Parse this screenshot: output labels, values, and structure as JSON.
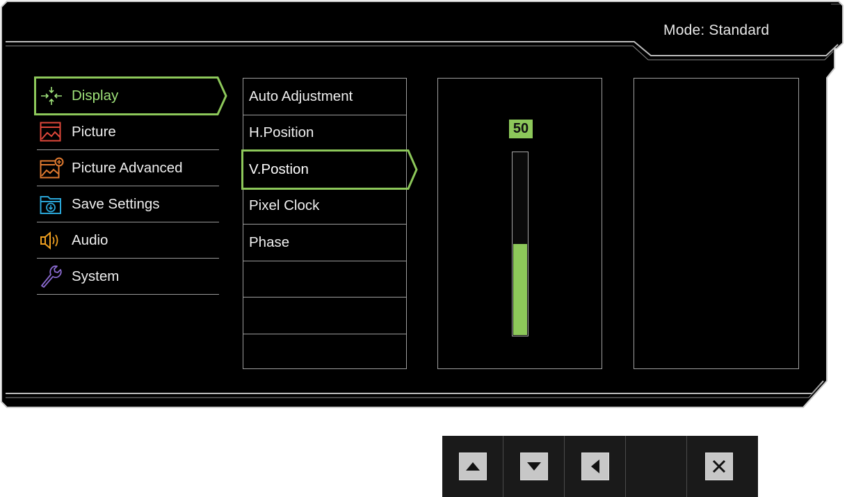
{
  "header": {
    "mode_text": "Mode: Standard"
  },
  "menu": {
    "items": [
      {
        "label": "Display",
        "icon": "display-adjust-icon",
        "selected": true
      },
      {
        "label": "Picture",
        "icon": "picture-icon"
      },
      {
        "label": "Picture Advanced",
        "icon": "picture-advanced-icon"
      },
      {
        "label": "Save Settings",
        "icon": "save-settings-icon"
      },
      {
        "label": "Audio",
        "icon": "audio-icon"
      },
      {
        "label": "System",
        "icon": "system-wrench-icon"
      }
    ]
  },
  "submenu": {
    "items": [
      {
        "label": "Auto Adjustment"
      },
      {
        "label": "H.Position"
      },
      {
        "label": "V.Postion",
        "selected": true
      },
      {
        "label": "Pixel Clock"
      },
      {
        "label": "Phase"
      },
      {
        "label": ""
      },
      {
        "label": ""
      },
      {
        "label": ""
      }
    ]
  },
  "value": {
    "display": "50",
    "level_percent": 50
  },
  "buttons": [
    {
      "icon": "up-arrow-icon"
    },
    {
      "icon": "down-arrow-icon"
    },
    {
      "icon": "left-arrow-icon"
    },
    {
      "icon": ""
    },
    {
      "icon": "close-icon"
    }
  ],
  "colors": {
    "accent_green": "#8dc85a",
    "osd_background": "#000000",
    "frame_outline": "#bdbdbd",
    "picture_icon": "#e0473a",
    "picture_advanced_icon": "#e07a30",
    "save_settings_icon": "#2aa6d8",
    "audio_icon": "#f0a020",
    "system_icon": "#8a6ad0"
  }
}
